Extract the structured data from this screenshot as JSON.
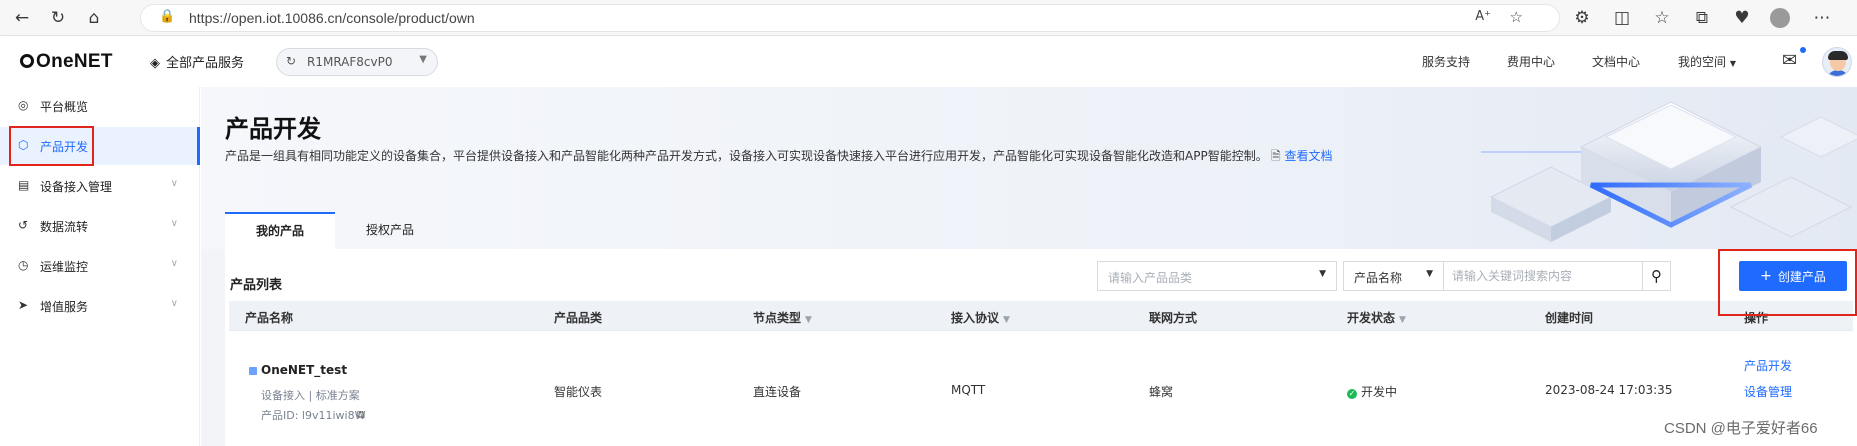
{
  "browser": {
    "url": "https://open.iot.10086.cn/console/product/own"
  },
  "topnav": {
    "logo": "OneNET",
    "all_products": "全部产品服务",
    "instance": "R1MRAF8cvP0",
    "links": [
      "服务支持",
      "费用中心",
      "文档中心",
      "我的空间"
    ]
  },
  "sidebar": {
    "items": [
      {
        "label": "平台概览",
        "icon": "overview-icon"
      },
      {
        "label": "产品开发",
        "icon": "product-icon"
      },
      {
        "label": "设备接入管理",
        "icon": "device-icon"
      },
      {
        "label": "数据流转",
        "icon": "dataflow-icon"
      },
      {
        "label": "运维监控",
        "icon": "monitor-icon"
      },
      {
        "label": "增值服务",
        "icon": "service-icon"
      }
    ]
  },
  "page": {
    "title": "产品开发",
    "description": "产品是一组具有相同功能定义的设备集合，平台提供设备接入和产品智能化两种产品开发方式，设备接入可实现设备快速接入平台进行应用开发，产品智能化可实现设备智能化改造和APP智能控制。",
    "doc_link": "查看文档",
    "tabs": [
      "我的产品",
      "授权产品"
    ]
  },
  "list": {
    "title": "产品列表",
    "category_placeholder": "请输入产品品类",
    "field_select": "产品名称",
    "keyword_placeholder": "请输入关键词搜索内容",
    "create_button": "创建产品"
  },
  "table": {
    "headers": [
      "产品名称",
      "产品品类",
      "节点类型",
      "接入协议",
      "联网方式",
      "开发状态",
      "创建时间",
      "操作"
    ],
    "rows": [
      {
        "name": "OneNET_test",
        "sub": "设备接入  |  标准方案",
        "product_id": "产品ID:  l9v11iwi8W",
        "category": "智能仪表",
        "node_type": "直连设备",
        "protocol": "MQTT",
        "network": "蜂窝",
        "status": "开发中",
        "created": "2023-08-24 17:03:35",
        "ops": [
          "产品开发",
          "设备管理"
        ]
      }
    ]
  },
  "watermark": "CSDN @电子爱好者66",
  "colors": {
    "accent": "#1f6bff",
    "highlight_box": "#e1251b",
    "status_ok": "#1db954"
  }
}
